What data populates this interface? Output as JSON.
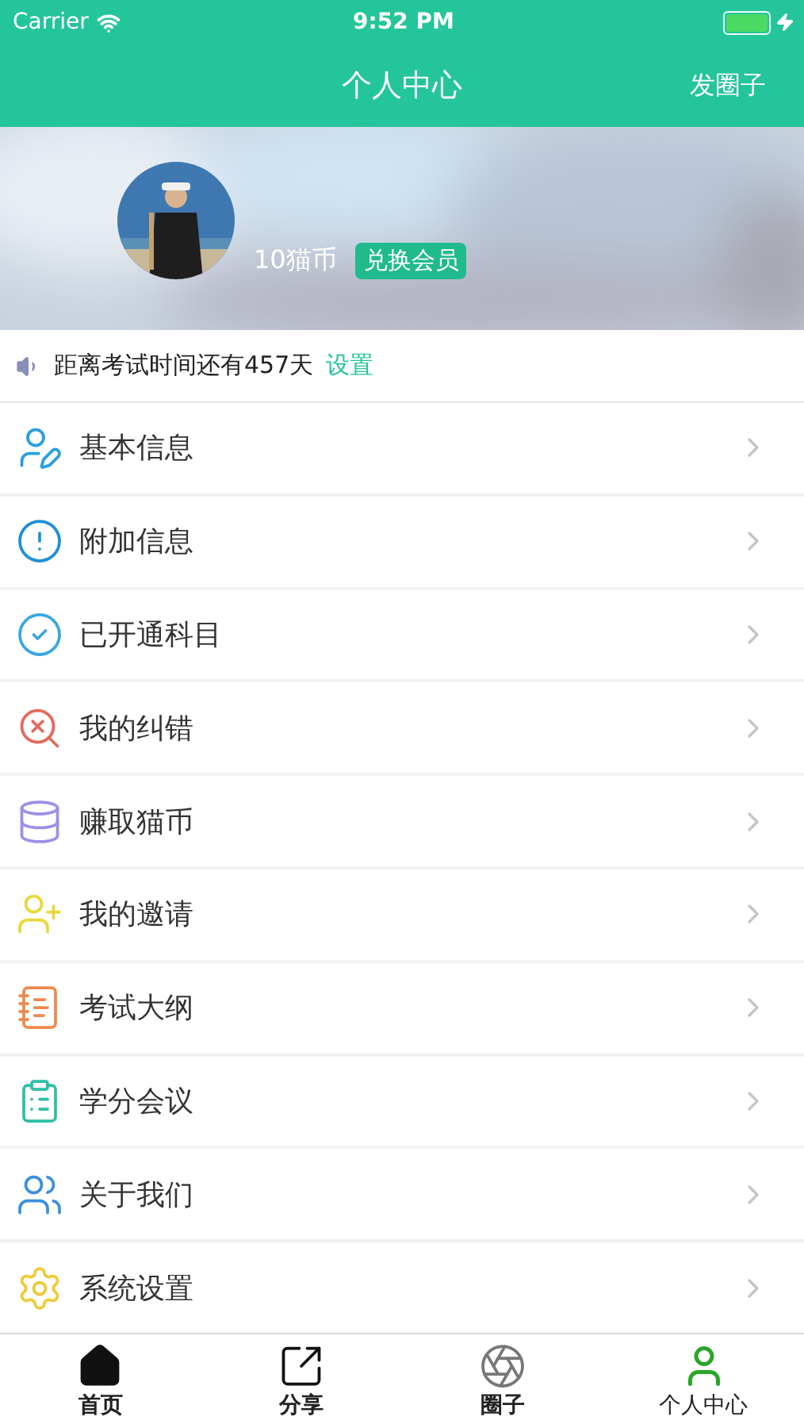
{
  "status_bar": {
    "carrier": "Carrier",
    "time": "9:52 PM"
  },
  "nav": {
    "title": "个人中心",
    "action": "发圈子"
  },
  "profile": {
    "coins": "10猫币",
    "badge": "兑换会员"
  },
  "notice": {
    "text": "距离考试时间还有457天",
    "link": "设置"
  },
  "menu": [
    {
      "label": "基本信息"
    },
    {
      "label": "附加信息"
    },
    {
      "label": "已开通科目"
    },
    {
      "label": "我的纠错"
    },
    {
      "label": "赚取猫币"
    },
    {
      "label": "我的邀请"
    },
    {
      "label": "考试大纲"
    },
    {
      "label": "学分会议"
    },
    {
      "label": "关于我们"
    },
    {
      "label": "系统设置"
    }
  ],
  "tabs": [
    {
      "label": "首页",
      "selected": false
    },
    {
      "label": "分享",
      "selected": false
    },
    {
      "label": "圈子",
      "selected": false
    },
    {
      "label": "个人中心",
      "selected": true
    }
  ]
}
